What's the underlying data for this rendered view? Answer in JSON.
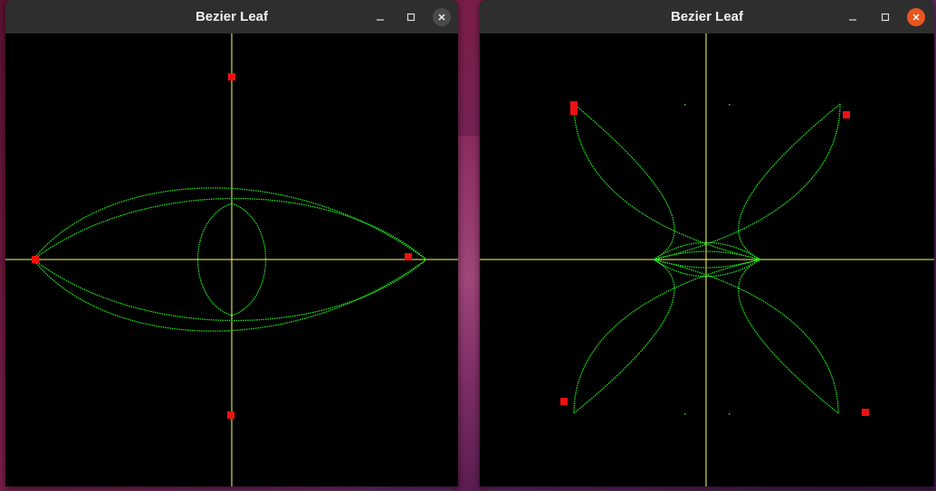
{
  "windows": [
    {
      "title": "Bezier Leaf",
      "active": false
    },
    {
      "title": "Bezier Leaf",
      "active": true
    }
  ],
  "colors": {
    "axis": "#ffff66",
    "curve": "#22e022",
    "control_point": "#ee1111",
    "canvas_bg": "#000000",
    "titlebar_bg": "#2e2e2e",
    "close_active": "#e95420"
  },
  "icons": [
    "minimize-icon",
    "maximize-icon",
    "close-icon"
  ]
}
